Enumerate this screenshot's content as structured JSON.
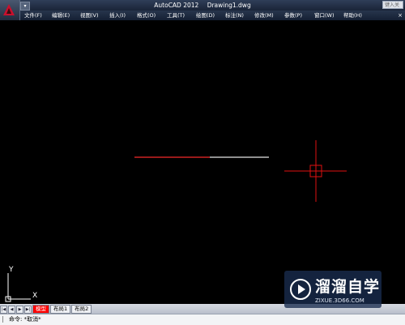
{
  "window": {
    "app_title": "AutoCAD 2012",
    "document_name": "Drawing1.dwg",
    "search_placeholder": "键入关"
  },
  "menu": {
    "items": [
      {
        "label": "文件(F)"
      },
      {
        "label": "编辑(E)"
      },
      {
        "label": "视图(V)"
      },
      {
        "label": "插入(I)"
      },
      {
        "label": "格式(O)"
      },
      {
        "label": "工具(T)"
      },
      {
        "label": "绘图(D)"
      },
      {
        "label": "标注(N)"
      },
      {
        "label": "修改(M)"
      },
      {
        "label": "参数(P)"
      },
      {
        "label": "窗口(W)"
      },
      {
        "label": "帮助(H)"
      }
    ],
    "close_glyph": "×"
  },
  "layout_tabs": {
    "nav": [
      "|◀",
      "◀",
      "▶",
      "▶|"
    ],
    "tabs": [
      {
        "label": "模型",
        "active": true
      },
      {
        "label": "布局1",
        "active": false
      },
      {
        "label": "布局2",
        "active": false
      }
    ]
  },
  "ucs": {
    "x_label": "X",
    "y_label": "Y"
  },
  "command_line": {
    "text": "命令: *取消*"
  },
  "watermark": {
    "title": "溜溜自学",
    "url": "ZIXUE.3D66.COM"
  },
  "colors": {
    "line_red": "#cc2222",
    "line_gray": "#bfbfbf",
    "crosshair": "#e01010",
    "canvas_bg": "#000000"
  }
}
